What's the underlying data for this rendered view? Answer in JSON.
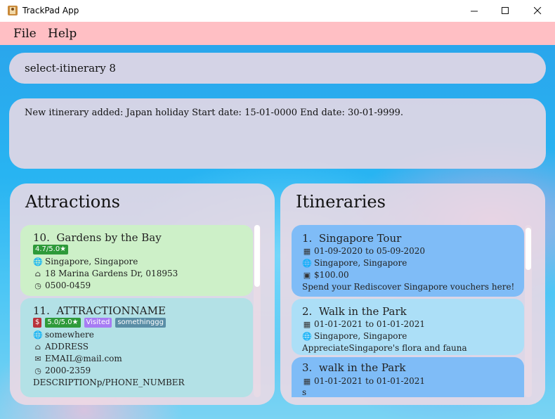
{
  "window": {
    "title": "TrackPad App"
  },
  "menu": {
    "file": "File",
    "help": "Help"
  },
  "command_box": {
    "value": "select-itinerary 8"
  },
  "result_box": {
    "text": "New itinerary added: Japan holiday Start date: 15-01-0000 End date: 30-01-9999."
  },
  "attractions": {
    "title": "Attractions",
    "items": [
      {
        "index": "10.",
        "name": "Gardens by the Bay",
        "rating": "4.7/5.0★",
        "location": "Singapore, Singapore",
        "address": "18 Marina Gardens Dr, 018953",
        "hours": "0500-0459"
      },
      {
        "index": "11.",
        "name": "ATTRACTIONNAME",
        "price": "$",
        "rating": "5.0/5.0★",
        "visited": "Visited",
        "tag": "somethinggg",
        "location": "somewhere",
        "address": "ADDRESS",
        "email": "EMAIL@mail.com",
        "hours": "2000-2359",
        "description": "DESCRIPTIONp/PHONE_NUMBER"
      }
    ]
  },
  "itineraries": {
    "title": "Itineraries",
    "items": [
      {
        "index": "1.",
        "name": "Singapore Tour",
        "dates": "01-09-2020 to 05-09-2020",
        "location": "Singapore, Singapore",
        "budget": "$100.00",
        "description": "Spend your Rediscover Singapore vouchers here!"
      },
      {
        "index": "2.",
        "name": "Walk in the Park",
        "dates": "01-01-2021 to 01-01-2021",
        "location": "Singapore, Singapore",
        "description": "AppreciateSingapore's flora and fauna"
      },
      {
        "index": "3.",
        "name": "walk in the Park",
        "dates": "01-01-2021 to 01-01-2021",
        "description": "s"
      }
    ]
  },
  "colors": {
    "menubar": "#ffbfc4",
    "attraction_card_selected": "#cdf0c8",
    "attraction_card": "#b3e1e6",
    "itinerary_card_selected": "#7fbcf7",
    "itinerary_card": "#acdff7",
    "badge_rating": "#2e9a3a",
    "badge_price": "#b8323a",
    "badge_visited": "#a77cf3",
    "badge_tag": "#5a8ea6"
  }
}
